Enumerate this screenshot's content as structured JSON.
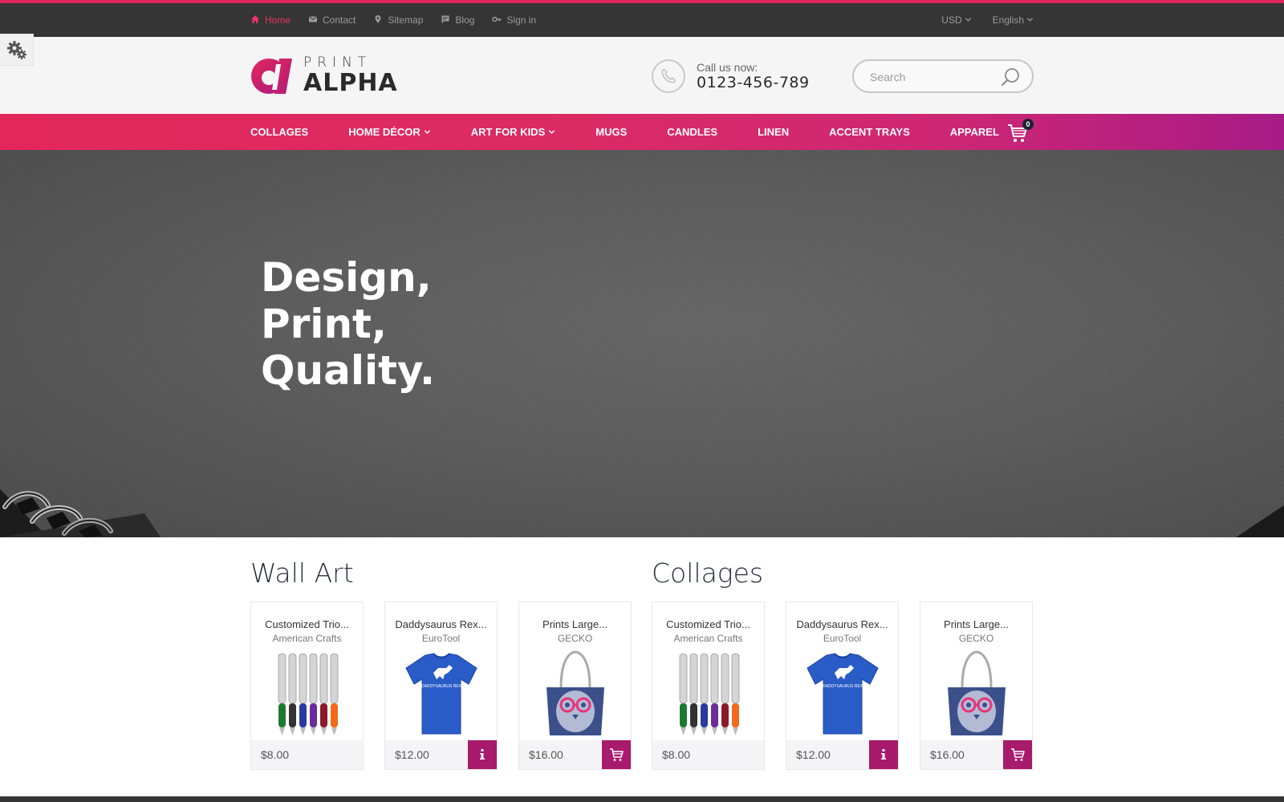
{
  "topbar": {
    "links": [
      {
        "label": "Home",
        "icon": "home-icon",
        "active": true
      },
      {
        "label": "Contact",
        "icon": "envelope-icon"
      },
      {
        "label": "Sitemap",
        "icon": "map-pin-icon"
      },
      {
        "label": "Blog",
        "icon": "chat-icon"
      },
      {
        "label": "Sign in",
        "icon": "key-icon"
      }
    ],
    "currency": "USD",
    "language": "English"
  },
  "header": {
    "logo_top": "PRINT",
    "logo_bottom": "ALPHA",
    "call_label": "Call us now:",
    "call_number": "0123-456-789",
    "search_placeholder": "Search"
  },
  "nav": {
    "items": [
      {
        "label": "COLLAGES",
        "dropdown": false
      },
      {
        "label": "HOME DÉCOR",
        "dropdown": true
      },
      {
        "label": "ART FOR KIDS",
        "dropdown": true
      },
      {
        "label": "MUGS",
        "dropdown": false
      },
      {
        "label": "CANDLES",
        "dropdown": false
      },
      {
        "label": "LINEN",
        "dropdown": false
      },
      {
        "label": "ACCENT TRAYS",
        "dropdown": false
      },
      {
        "label": "APPAREL",
        "dropdown": false
      }
    ],
    "cart_count": "0"
  },
  "hero": {
    "lines": [
      "Design,",
      "Print,",
      "Quality."
    ]
  },
  "sections": [
    {
      "title": "Wall Art",
      "products": [
        {
          "name": "Customized Trio...",
          "brand": "American Crafts",
          "price": "$8.00",
          "image": "pens",
          "action": "none"
        },
        {
          "name": "Daddysaurus Rex...",
          "brand": "EuroTool",
          "price": "$12.00",
          "image": "tshirt",
          "action": "info"
        },
        {
          "name": "Prints Large...",
          "brand": "GECKO",
          "price": "$16.00",
          "image": "tote",
          "action": "cart"
        }
      ]
    },
    {
      "title": "Collages",
      "products": [
        {
          "name": "Customized Trio...",
          "brand": "American Crafts",
          "price": "$8.00",
          "image": "pens",
          "action": "none"
        },
        {
          "name": "Daddysaurus Rex...",
          "brand": "EuroTool",
          "price": "$12.00",
          "image": "tshirt",
          "action": "info"
        },
        {
          "name": "Prints Large...",
          "brand": "GECKO",
          "price": "$16.00",
          "image": "tote",
          "action": "cart"
        }
      ]
    }
  ],
  "tshirt_print": "DADDYSAURUS REX",
  "colors": {
    "accent": "#e0245e",
    "accent_purple": "#a81a6b",
    "topbar_bg": "#353535",
    "header_bg": "#f5f5f5"
  }
}
